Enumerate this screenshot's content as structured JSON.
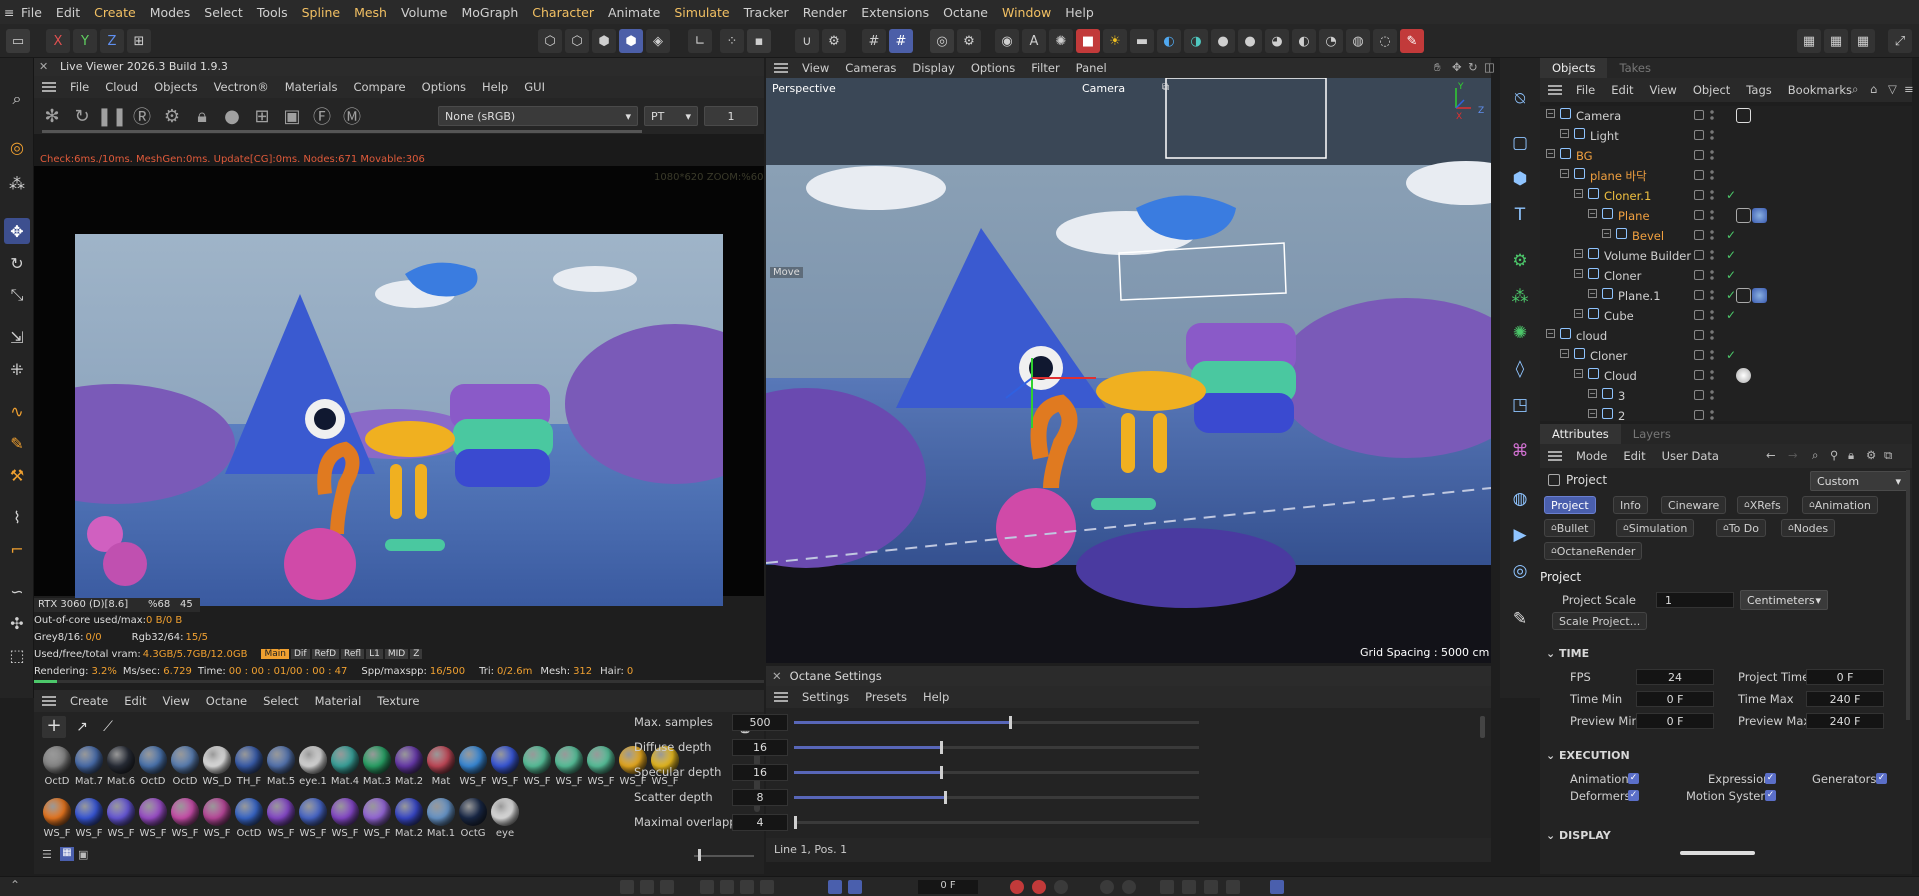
{
  "menubar": {
    "items": [
      {
        "label": "File",
        "hl": false
      },
      {
        "label": "Edit",
        "hl": false
      },
      {
        "label": "Create",
        "hl": true
      },
      {
        "label": "Modes",
        "hl": false
      },
      {
        "label": "Select",
        "hl": false
      },
      {
        "label": "Tools",
        "hl": false
      },
      {
        "label": "Spline",
        "hl": true
      },
      {
        "label": "Mesh",
        "hl": true
      },
      {
        "label": "Volume",
        "hl": false
      },
      {
        "label": "MoGraph",
        "hl": false
      },
      {
        "label": "Character",
        "hl": true
      },
      {
        "label": "Animate",
        "hl": false
      },
      {
        "label": "Simulate",
        "hl": true
      },
      {
        "label": "Tracker",
        "hl": false
      },
      {
        "label": "Render",
        "hl": false
      },
      {
        "label": "Extensions",
        "hl": false
      },
      {
        "label": "Octane",
        "hl": false
      },
      {
        "label": "Window",
        "hl": true
      },
      {
        "label": "Help",
        "hl": false
      }
    ]
  },
  "axis_toolbar": {
    "x": "X",
    "y": "Y",
    "z": "Z"
  },
  "live_viewer": {
    "title": "Live Viewer 2026.3 Build 1.9.3",
    "menu": [
      "File",
      "Cloud",
      "Objects",
      "Vectron®",
      "Materials",
      "Compare",
      "Options",
      "Help",
      "GUI"
    ],
    "colorspace": "None (sRGB)",
    "kernel": "PT",
    "value": "1",
    "check_status": "Check:6ms./10ms. MeshGen:0ms. Update[CG]:0ms. Nodes:671 Movable:306",
    "resolution": "1080*620 ZOOM:%60",
    "gpu_name": "RTX 3060 (D)[8.6]",
    "gpu_pct": "%68",
    "gpu_temp": "45",
    "ooc_label": "Out-of-core used/max:",
    "ooc_value": "0 B/0 B",
    "grey_label": "Grey8/16:",
    "grey_value": "0/0",
    "rgb_label": "Rgb32/64:",
    "rgb_value": "15/5",
    "vram_label": "Used/free/total vram:",
    "vram_value": "4.3GB/5.7GB/12.0GB",
    "chips": [
      "Main",
      "Dif",
      "RefD",
      "Refl",
      "L1",
      "MID",
      "Z"
    ],
    "render_label": "Rendering:",
    "render_pct": "3.2%",
    "ms_label": "Ms/sec:",
    "ms_value": "6.729",
    "time_label": "Time:",
    "time_value": "00 : 00 : 01/00 : 00 : 47",
    "spp_label": "Spp/maxspp:",
    "spp_value": "16/500",
    "tri_label": "Tri:",
    "tri_value": "0/2.6m",
    "mesh_label": "Mesh:",
    "mesh_value": "312",
    "hair_label": "Hair:",
    "hair_value": "0",
    "render_progress": 0.032
  },
  "viewport": {
    "menu": [
      "View",
      "Cameras",
      "Display",
      "Options",
      "Filter",
      "Panel"
    ],
    "label_perspective": "Perspective",
    "label_camera": "Camera",
    "move_label": "Move",
    "grid_spacing": "Grid Spacing : 5000 cm",
    "axis_x": "X",
    "axis_y": "Y",
    "axis_z": "Z"
  },
  "material_manager": {
    "menu": [
      "Create",
      "Edit",
      "View",
      "Octane",
      "Select",
      "Material",
      "Texture"
    ],
    "row1": [
      {
        "name": "OctD",
        "color": "#8a8a8a"
      },
      {
        "name": "Mat.7",
        "color": "#4a6fb0"
      },
      {
        "name": "Mat.6",
        "color": "#2a2f3a"
      },
      {
        "name": "OctD",
        "color": "#4d78b5"
      },
      {
        "name": "OctD",
        "color": "#5c82b8"
      },
      {
        "name": "WS_D",
        "color": "#e8e8e8"
      },
      {
        "name": "TH_F",
        "color": "#3a5fb0"
      },
      {
        "name": "Mat.5",
        "color": "#5677b5"
      },
      {
        "name": "eye.1",
        "color": "#e0e0e0"
      },
      {
        "name": "Mat.4",
        "color": "#3aa8a0"
      },
      {
        "name": "Mat.3",
        "color": "#2aa86a"
      },
      {
        "name": "Mat.2",
        "color": "#6a3ab0"
      },
      {
        "name": "Mat",
        "color": "#c84a5a"
      },
      {
        "name": "WS_F",
        "color": "#3a8ee0"
      },
      {
        "name": "WS_F",
        "color": "#3a5ae0"
      },
      {
        "name": "WS_F",
        "color": "#5ac8a0"
      },
      {
        "name": "WS_F",
        "color": "#5ac8a0"
      },
      {
        "name": "WS_F",
        "color": "#5ac8a0"
      },
      {
        "name": "WS_F",
        "color": "#f0b020"
      },
      {
        "name": "WS_F",
        "color": "#f0c020"
      }
    ],
    "row2": [
      {
        "name": "WS_F",
        "color": "#f07a20"
      },
      {
        "name": "WS_F",
        "color": "#3a5ae0"
      },
      {
        "name": "WS_F",
        "color": "#6a5ae0"
      },
      {
        "name": "WS_F",
        "color": "#a050d0"
      },
      {
        "name": "WS_F",
        "color": "#d050b0"
      },
      {
        "name": "WS_F",
        "color": "#c04aa0"
      },
      {
        "name": "OctD",
        "color": "#3a6ad0"
      },
      {
        "name": "WS_F",
        "color": "#8a4ad0"
      },
      {
        "name": "WS_F",
        "color": "#4a6ad0"
      },
      {
        "name": "WS_F",
        "color": "#8a4ad0"
      },
      {
        "name": "WS_F",
        "color": "#9a6ae0"
      },
      {
        "name": "Mat.2",
        "color": "#3a4ad0"
      },
      {
        "name": "Mat.1",
        "color": "#6a9ad0"
      },
      {
        "name": "OctG",
        "color": "#1a2a4a"
      },
      {
        "name": "eye",
        "color": "#e8e8e8"
      }
    ]
  },
  "octane_settings": {
    "title": "Octane Settings",
    "menu": [
      "Settings",
      "Presets",
      "Help"
    ],
    "rows": [
      {
        "name": "Max. samples",
        "value": "500",
        "fraction": 0.53
      },
      {
        "name": "Diffuse depth",
        "value": "16",
        "fraction": 0.36
      },
      {
        "name": "Specular depth",
        "value": "16",
        "fraction": 0.36
      },
      {
        "name": "Scatter depth",
        "value": "8",
        "fraction": 0.37
      },
      {
        "name": "Maximal overlapping vo",
        "value": "4",
        "fraction": 0.0
      }
    ],
    "status": "Line 1, Pos. 1"
  },
  "objects_panel": {
    "tabs": [
      "Objects",
      "Takes"
    ],
    "menu": [
      "File",
      "Edit",
      "View",
      "Object",
      "Tags",
      "Bookmarks"
    ],
    "rows": [
      {
        "name": "Camera",
        "indent": 0,
        "color": "#d0d0d0",
        "check": false
      },
      {
        "name": "Light",
        "indent": 1,
        "color": "#d0d0d0",
        "check": false
      },
      {
        "name": "BG",
        "indent": 0,
        "color": "#f0a040",
        "check": false
      },
      {
        "name": "plane 바닥",
        "indent": 1,
        "color": "#f0a040",
        "check": false
      },
      {
        "name": "Cloner.1",
        "indent": 2,
        "color": "#f0c040",
        "check": true
      },
      {
        "name": "Plane",
        "indent": 3,
        "color": "#f0a040",
        "check": false
      },
      {
        "name": "Bevel",
        "indent": 4,
        "color": "#f0a040",
        "check": true
      },
      {
        "name": "Volume Builder",
        "indent": 2,
        "color": "#d0d0d0",
        "check": true
      },
      {
        "name": "Cloner",
        "indent": 2,
        "color": "#d0d0d0",
        "check": true
      },
      {
        "name": "Plane.1",
        "indent": 3,
        "color": "#d0d0d0",
        "check": true
      },
      {
        "name": "Cube",
        "indent": 2,
        "color": "#d0d0d0",
        "check": true
      },
      {
        "name": "cloud",
        "indent": 0,
        "color": "#d0d0d0",
        "check": false
      },
      {
        "name": "Cloner",
        "indent": 1,
        "color": "#d0d0d0",
        "check": true
      },
      {
        "name": "Cloud",
        "indent": 2,
        "color": "#d0d0d0",
        "check": false
      },
      {
        "name": "3",
        "indent": 3,
        "color": "#d0d0d0",
        "check": false
      },
      {
        "name": "2",
        "indent": 3,
        "color": "#d0d0d0",
        "check": false
      }
    ]
  },
  "attributes": {
    "tabs": [
      "Attributes",
      "Layers"
    ],
    "menu": [
      "Mode",
      "Edit",
      "User Data"
    ],
    "object": "Project",
    "preset": "Custom",
    "buttons_row1": [
      "Project",
      "Info",
      "Cineware",
      "XRefs",
      "Animation"
    ],
    "buttons_row2": [
      "Bullet",
      "Simulation",
      "To Do",
      "Nodes"
    ],
    "buttons_row3": [
      "OctaneRender"
    ],
    "section_title": "Project",
    "project_scale_label": "Project Scale",
    "project_scale_value": "1",
    "project_scale_unit": "Centimeters",
    "scale_button": "Scale Project...",
    "time_section": "TIME",
    "fps_label": "FPS",
    "fps_value": "24",
    "project_time_label": "Project Time",
    "project_time_value": "0 F",
    "time_min_label": "Time Min",
    "time_min_value": "0 F",
    "time_max_label": "Time Max",
    "time_max_value": "240 F",
    "preview_min_label": "Preview Min",
    "preview_min_value": "0 F",
    "preview_max_label": "Preview Max",
    "preview_max_value": "240 F",
    "execution_section": "EXECUTION",
    "exec": [
      "Animation",
      "Expression",
      "Generators",
      "Deformers",
      "Motion System"
    ],
    "display_section": "DISPLAY"
  },
  "timeline": {
    "frame": "0 F"
  },
  "colors": {
    "accent": "#4a5fad",
    "highlight_menu": "#f2c063",
    "object_orange": "#f0a040",
    "check_green": "#4cc76a"
  }
}
